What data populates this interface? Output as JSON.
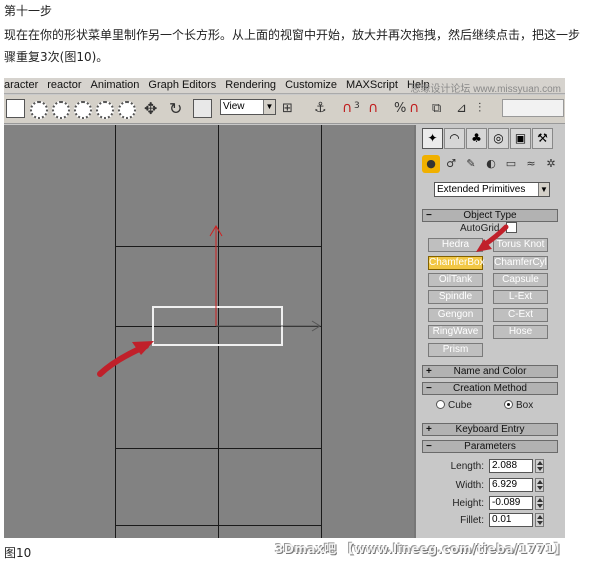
{
  "article": {
    "step_title": "第十一步",
    "instruction": "现在在你的形状菜单里制作另一个长方形。从上面的视窗中开始，放大并再次拖拽，然后继续点击，把这一步骤重复3次(图10)。",
    "figure_caption": "图10",
    "credit": "3Dmax吧 【www.lineeg.com/tieba/1771】"
  },
  "app": {
    "menu": [
      "aracter",
      "reactor",
      "Animation",
      "Graph Editors",
      "Rendering",
      "Customize",
      "MAXScript",
      "Help"
    ],
    "watermark": "思缘设计论坛 www.missyuan.com",
    "toolbar": {
      "view_select_value": "View",
      "snap_label": "3",
      "percent_label": "%"
    },
    "command_panel": {
      "category_select_value": "Extended Primitives",
      "object_type": {
        "header": "Object Type",
        "autogrid_label": "AutoGrid",
        "buttons": [
          "Hedra",
          "Torus Knot",
          "ChamferBox",
          "ChamferCyl",
          "OilTank",
          "Capsule",
          "Spindle",
          "L-Ext",
          "Gengon",
          "C-Ext",
          "RingWave",
          "Hose",
          "Prism"
        ],
        "active_button": "ChamferBox"
      },
      "name_and_color": {
        "header": "Name and Color"
      },
      "creation_method": {
        "header": "Creation Method",
        "options": [
          "Cube",
          "Box"
        ],
        "selected": "Box"
      },
      "keyboard_entry": {
        "header": "Keyboard Entry"
      },
      "parameters": {
        "header": "Parameters",
        "fields": [
          {
            "label": "Length:",
            "value": "2.088"
          },
          {
            "label": "Width:",
            "value": "6.929"
          },
          {
            "label": "Height:",
            "value": "-0.089"
          },
          {
            "label": "Fillet:",
            "value": "0.01"
          }
        ]
      }
    },
    "colors": {
      "viewport_bg": "#828282",
      "active_button": "#f2c744",
      "annotation_arrow": "#c0202a",
      "axis_gizmo": "#d02020"
    }
  }
}
